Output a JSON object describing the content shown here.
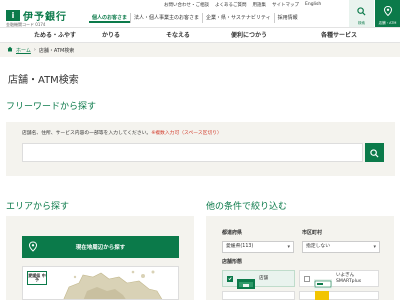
{
  "header": {
    "logo_mark": "i",
    "logo_text": "伊予銀行",
    "bank_code": "金融機関コード 0174",
    "util_links": [
      "お問い合わせ・ご相談",
      "よくあるご質問",
      "用語集",
      "サイトマップ",
      "English"
    ],
    "segments": [
      "個人のお客さま",
      "法人・個人事業主のお客さま",
      "企業・県・サステナビリティ",
      "採用情報"
    ],
    "icon_buttons": [
      {
        "icon": "search-icon",
        "label": "検索"
      },
      {
        "icon": "location-pin-icon",
        "label": "店舗・ATM"
      }
    ]
  },
  "nav": [
    "ためる・ふやす",
    "かりる",
    "そなえる",
    "便利につかう",
    "各種サービス"
  ],
  "breadcrumb": {
    "home": "ホーム",
    "current": "店舗・ATM検索"
  },
  "page_title": "店舗・ATM検索",
  "freeword": {
    "title": "フリーワードから探す",
    "hint": "店舗名、住所、サービス内容の一部等を入力してください。",
    "hint_note": "※複数入力可（スペース区切り）",
    "placeholder": ""
  },
  "area": {
    "title": "エリアから探す",
    "locate_button": "現在地周辺から探す",
    "map_label": "愛媛県 中予"
  },
  "filter": {
    "title": "他の条件で絞り込む",
    "pref_label": "都道府県",
    "pref_value": "愛媛県(113)",
    "city_label": "市区町村",
    "city_value": "指定しない",
    "type_label": "店舗形態",
    "types": [
      {
        "label": "店舗",
        "selected": true
      },
      {
        "label": "いよぎん SMARTplus",
        "selected": false
      }
    ]
  },
  "colors": {
    "brand_green": "#0b7a4a",
    "panel_bg": "#f4f3ee",
    "note_red": "#d23a2a"
  }
}
